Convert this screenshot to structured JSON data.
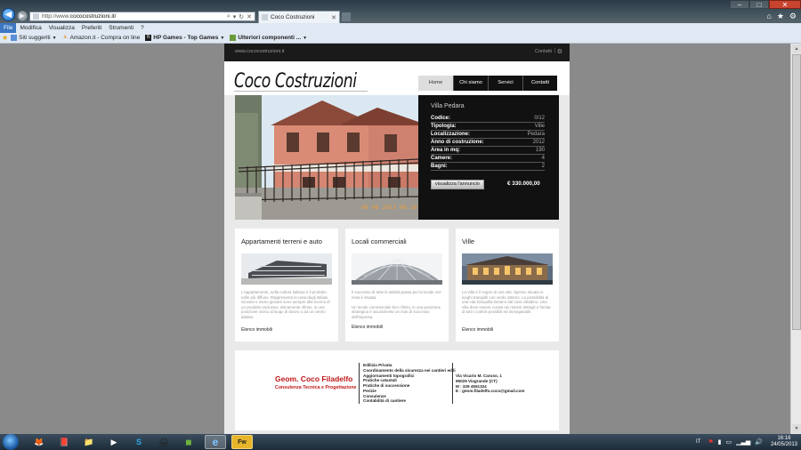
{
  "browser": {
    "url_prefix": "http://www.",
    "url_domain": "cococostruzioni.it/",
    "tab_title": "Coco Costruzioni",
    "menu": [
      "File",
      "Modifica",
      "Visualizza",
      "Preferiti",
      "Strumenti",
      "?"
    ],
    "bookmarks": [
      {
        "label": "Siti suggeriti",
        "caret": true
      },
      {
        "label": "Amazon.it - Compra on line",
        "caret": false
      },
      {
        "label": "HP Games - Top Games",
        "caret": true
      },
      {
        "label": "Ulteriori componenti ...",
        "caret": true
      }
    ],
    "icons": {
      "back": "back-arrow-icon",
      "forward": "forward-arrow-icon",
      "home": "home-icon",
      "favorites": "star-icon",
      "tools": "gear-icon"
    }
  },
  "site": {
    "topbar_url": "www.cococostruzioni.it",
    "topbar_contact": "Contatti",
    "topbar_sep": "|",
    "logo": "Coco Costruzioni",
    "nav": [
      {
        "label": "Home",
        "active": true
      },
      {
        "label": "Chi siamo",
        "active": false
      },
      {
        "label": "Servici",
        "active": false
      },
      {
        "label": "Contatti",
        "active": false
      }
    ],
    "featured": {
      "title": "Villa Pedara",
      "specs": [
        {
          "k": "Codice:",
          "v": "0/12"
        },
        {
          "k": "Tipologia:",
          "v": "Ville"
        },
        {
          "k": "Localizzazione:",
          "v": "Pedara"
        },
        {
          "k": "Anno di costruzione:",
          "v": "2012"
        },
        {
          "k": "Area in mq:",
          "v": "190"
        },
        {
          "k": "Camere:",
          "v": "4"
        },
        {
          "k": "Bagni:",
          "v": "2"
        }
      ],
      "button": "visualizza l'annuncio",
      "price": "€ 330.000,00",
      "photo_stamp": "06 06 2012 08 10"
    },
    "cards": [
      {
        "title": "Appartamenti terreni e auto",
        "text": "L'appartamento, nella cultura italiana è il prodotto edile più diffuso. Rappresenta la casa degli italiani. Giovani e meno giovani sono sempre alla ricerca di un prodotto esclusivo, elitcamente rifinito, in una posizione vicino al luogo di lavoro o ad un centro abitato.",
        "link": "Elenco immobili"
      },
      {
        "title": "Locali commerciali",
        "text": "Il successo di tutte le attività passa per la locale ove essa è situata.\n\nUn locale commerciale ben rifinito, in una posizione strategica è sicuramente un moti di successo dell'impresa.",
        "link": "Elenco immobili"
      },
      {
        "title": "Ville",
        "text": "La Villa è il sogno di una vita. Spesso situata in luoghi tranquilli con verde attorno. La possibilità di una vita tranquilla lontano dal caos cittadino. Una villa deve essere curata nei minimi dettagli e fornita di tutti i confort possibili ed immaginabili.",
        "link": "Elenco immobili"
      }
    ],
    "footer": {
      "name": "Geom. Coco Filadelfo",
      "subtitle": "Consulenza Tecnica e Progettazione",
      "services": [
        "Edilizia Privata",
        "Coordinamento della sicurezza nei cantieri edili",
        "Aggiornamenti topografici",
        "Pratiche catastali",
        "Pratiche di successione",
        "Perizie",
        "Consulenze",
        "Contabilità di cantiere"
      ],
      "contacts": [
        "Via Vicario M. Caruso, 1",
        "95029 Viagrande (CT)",
        "M : 329 4551324",
        "E : geom.filadelfo.coco@gmail.com"
      ]
    }
  },
  "taskbar": {
    "lang": "IT",
    "time": "16:16",
    "date": "24/05/2013",
    "apps": [
      {
        "name": "firefox-icon",
        "glyph": "🦊",
        "active": false
      },
      {
        "name": "office-icon",
        "glyph": "📕",
        "active": false
      },
      {
        "name": "folder-icon",
        "glyph": "📁",
        "active": false
      },
      {
        "name": "media-player-icon",
        "glyph": "▶",
        "active": false
      },
      {
        "name": "skype-icon",
        "glyph": "S",
        "active": false
      },
      {
        "name": "printer-icon",
        "glyph": "🖨",
        "active": false
      },
      {
        "name": "hp-icon",
        "glyph": "◼",
        "active": false
      },
      {
        "name": "internet-explorer-icon",
        "glyph": "e",
        "active": true
      },
      {
        "name": "fireworks-icon",
        "glyph": "Fw",
        "active": true
      }
    ]
  },
  "colors": {
    "brand_red": "#c01818",
    "nav_black": "#111111",
    "page_bg": "#e9e9e9",
    "ie_blue": "#1566c4",
    "date_stamp": "#f09a3a"
  }
}
